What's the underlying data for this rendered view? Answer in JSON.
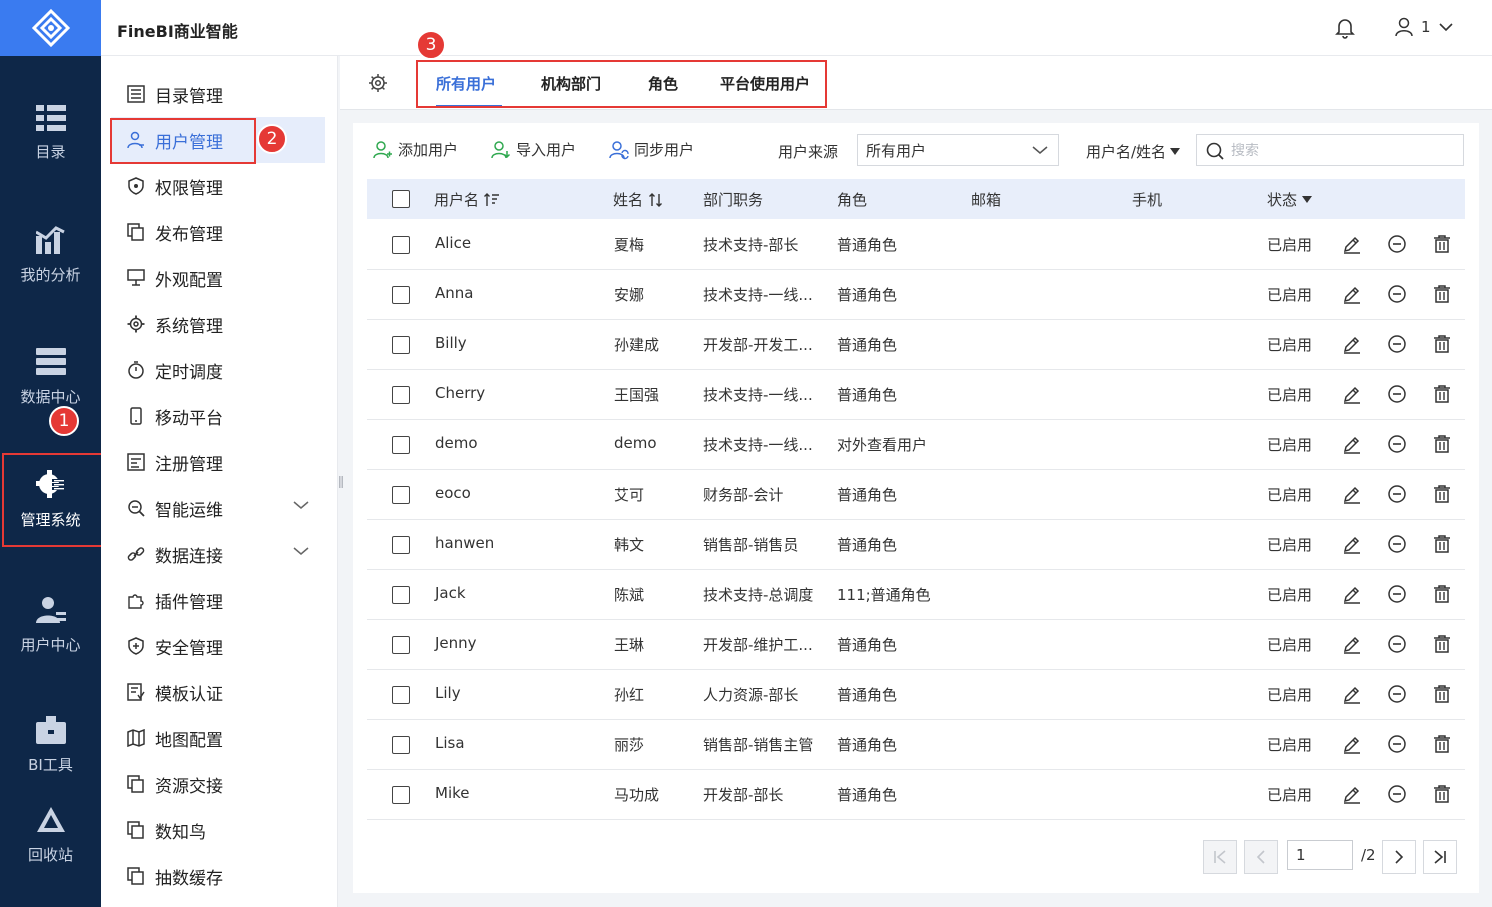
{
  "app": {
    "title": "FineBI商业智能",
    "user_name": "1"
  },
  "nav": [
    {
      "label": "目录",
      "icon": "catalog-icon"
    },
    {
      "label": "我的分析",
      "icon": "analysis-icon"
    },
    {
      "label": "数据中心",
      "icon": "data-center-icon"
    },
    {
      "label": "管理系统",
      "icon": "admin-gear-icon",
      "active": true
    },
    {
      "label": "用户中心",
      "icon": "user-center-icon"
    },
    {
      "label": "BI工具",
      "icon": "toolbox-icon"
    },
    {
      "label": "回收站",
      "icon": "recycle-icon"
    }
  ],
  "annotations": {
    "badge1": "1",
    "badge2": "2",
    "badge3": "3"
  },
  "sidebar": [
    {
      "label": "目录管理"
    },
    {
      "label": "用户管理",
      "active": true
    },
    {
      "label": "权限管理"
    },
    {
      "label": "发布管理"
    },
    {
      "label": "外观配置"
    },
    {
      "label": "系统管理"
    },
    {
      "label": "定时调度"
    },
    {
      "label": "移动平台"
    },
    {
      "label": "注册管理"
    },
    {
      "label": "智能运维",
      "expandable": true
    },
    {
      "label": "数据连接",
      "expandable": true
    },
    {
      "label": "插件管理"
    },
    {
      "label": "安全管理"
    },
    {
      "label": "模板认证"
    },
    {
      "label": "地图配置"
    },
    {
      "label": "资源交接"
    },
    {
      "label": "数知鸟"
    },
    {
      "label": "抽数缓存"
    }
  ],
  "tabs": [
    {
      "label": "所有用户",
      "active": true
    },
    {
      "label": "机构部门"
    },
    {
      "label": "角色"
    },
    {
      "label": "平台使用用户"
    }
  ],
  "toolbar": {
    "add_user": "添加用户",
    "import_user": "导入用户",
    "sync_user": "同步用户",
    "source_label": "用户来源",
    "source_value": "所有用户",
    "search_field": "用户名/姓名",
    "search_placeholder": "搜索"
  },
  "table": {
    "headers": {
      "username": "用户名",
      "name": "姓名",
      "dept": "部门职务",
      "role": "角色",
      "email": "邮箱",
      "phone": "手机",
      "status": "状态"
    },
    "rows": [
      {
        "username": "Alice",
        "name": "夏梅",
        "dept": "技术支持-部长",
        "role": "普通角色",
        "status": "已启用"
      },
      {
        "username": "Anna",
        "name": "安娜",
        "dept": "技术支持-一线...",
        "role": "普通角色",
        "status": "已启用"
      },
      {
        "username": "Billy",
        "name": "孙建成",
        "dept": "开发部-开发工...",
        "role": "普通角色",
        "status": "已启用"
      },
      {
        "username": "Cherry",
        "name": "王国强",
        "dept": "技术支持-一线...",
        "role": "普通角色",
        "status": "已启用"
      },
      {
        "username": "demo",
        "name": "demo",
        "dept": "技术支持-一线...",
        "role": "对外查看用户",
        "status": "已启用"
      },
      {
        "username": "eoco",
        "name": "艾可",
        "dept": "财务部-会计",
        "role": "普通角色",
        "status": "已启用"
      },
      {
        "username": "hanwen",
        "name": "韩文",
        "dept": "销售部-销售员",
        "role": "普通角色",
        "status": "已启用"
      },
      {
        "username": "Jack",
        "name": "陈斌",
        "dept": "技术支持-总调度",
        "role": "111;普通角色",
        "status": "已启用"
      },
      {
        "username": "Jenny",
        "name": "王琳",
        "dept": "开发部-维护工...",
        "role": "普通角色",
        "status": "已启用"
      },
      {
        "username": "Lily",
        "name": "孙红",
        "dept": "人力资源-部长",
        "role": "普通角色",
        "status": "已启用"
      },
      {
        "username": "Lisa",
        "name": "丽莎",
        "dept": "销售部-销售主管",
        "role": "普通角色",
        "status": "已启用"
      },
      {
        "username": "Mike",
        "name": "马功成",
        "dept": "开发部-部长",
        "role": "普通角色",
        "status": "已启用"
      }
    ]
  },
  "pagination": {
    "current": "1",
    "total": "/2"
  },
  "colors": {
    "accent": "#3a6fd8",
    "nav_bg": "#0e2748",
    "logo_bg": "#3a7bf0",
    "annotation_red": "#e53935"
  }
}
